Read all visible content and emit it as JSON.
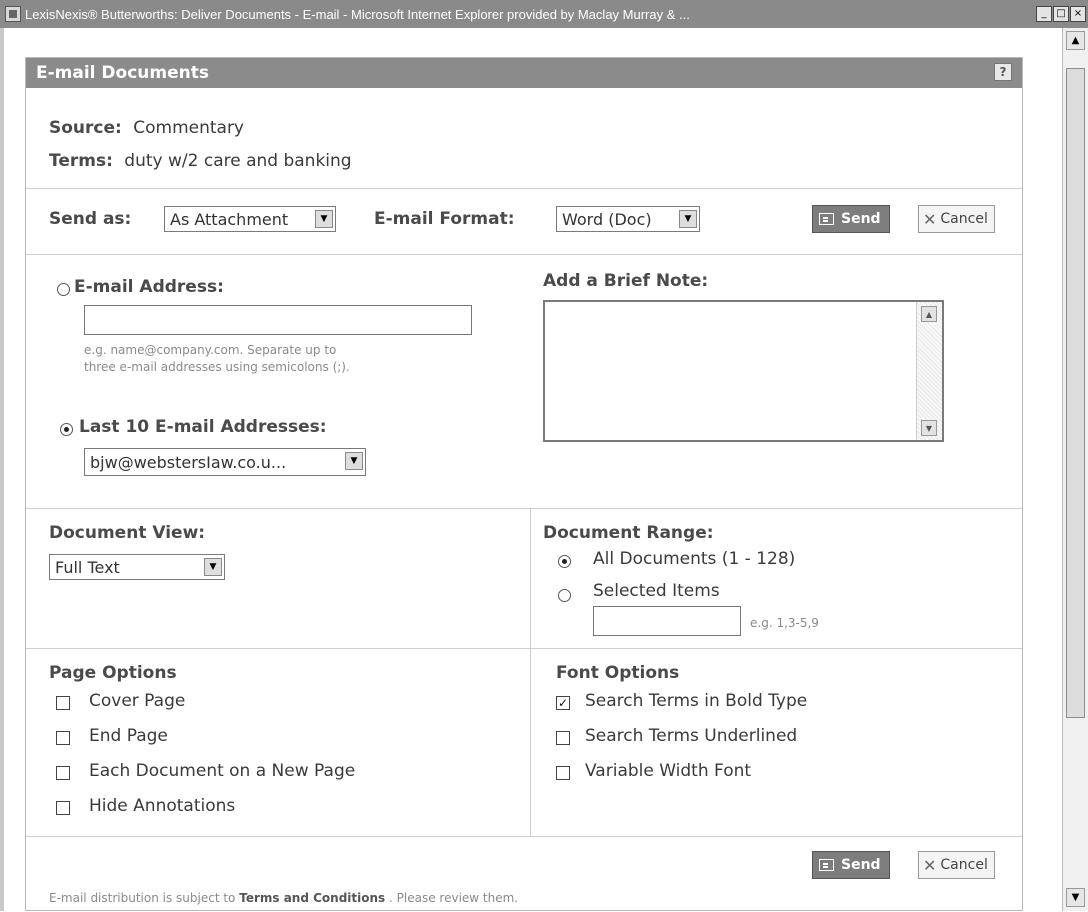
{
  "window": {
    "title": "LexisNexis® Butterworths: Deliver Documents - E-mail - Microsoft Internet Explorer provided by Maclay Murray & ..."
  },
  "dialog": {
    "title": "E-mail Documents",
    "help": "?",
    "source_label": "Source:",
    "source_value": "Commentary",
    "terms_label": "Terms:",
    "terms_value": "duty w/2 care and banking"
  },
  "delivery": {
    "send_as_label": "Send as:",
    "send_as_value": "As Attachment",
    "format_label": "E-mail Format:",
    "format_value": "Word (Doc)",
    "send_label": "Send",
    "cancel_label": "Cancel"
  },
  "recipient": {
    "email_label": "E-mail Address:",
    "email_value": "",
    "email_hint_line1": "e.g. name@company.com. Separate up to",
    "email_hint_line2": "three e-mail addresses using semicolons (;).",
    "last10_label": "Last 10 E-mail Addresses:",
    "last10_value": "bjw@webstersIaw.co.u...",
    "note_label": "Add a Brief Note:",
    "note_value": "",
    "email_selected": false,
    "last10_selected": true
  },
  "view": {
    "label": "Document View:",
    "value": "Full Text"
  },
  "range": {
    "label": "Document Range:",
    "all_label": "All Documents (1 - 128)",
    "selected_label": "Selected Items",
    "selected_hint": "e.g. 1,3-5,9",
    "all_selected": true
  },
  "page_options": {
    "label": "Page Options",
    "items": [
      {
        "label": "Cover Page",
        "checked": false
      },
      {
        "label": "End Page",
        "checked": false
      },
      {
        "label": "Each Document on a New Page",
        "checked": false
      },
      {
        "label": "Hide Annotations",
        "checked": false
      }
    ]
  },
  "font_options": {
    "label": "Font Options",
    "items": [
      {
        "label": "Search Terms in Bold Type",
        "checked": true
      },
      {
        "label": "Search Terms Underlined",
        "checked": false
      },
      {
        "label": "Variable Width Font",
        "checked": false
      }
    ]
  },
  "footer": {
    "text_before": "E-mail distribution is subject to",
    "link": "Terms and Conditions",
    "text_after": ". Please review them."
  }
}
